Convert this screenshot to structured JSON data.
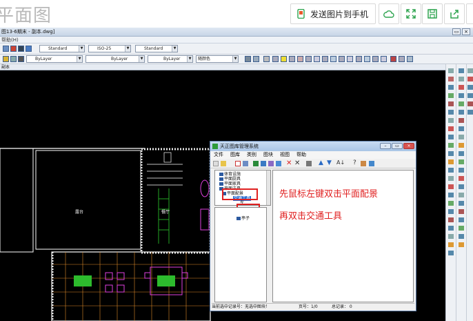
{
  "banner": {
    "title": "平面图",
    "send_label": "发送图片到手机",
    "colors": {
      "green": "#2ea44f"
    }
  },
  "app": {
    "title": "图13-6期末 - 副本.dwg]",
    "menu": "帮助(H)",
    "text_style": "Standard",
    "dim_style": "ISO-25",
    "table_style": "Standard",
    "layer": "ByLayer",
    "linetype": "ByLayer",
    "lineweight": "ByLayer",
    "color": "随颜色",
    "tab": "副本"
  },
  "dialog": {
    "title": "天正图库管理系统",
    "menu": [
      "文件",
      "图库",
      "类别",
      "图块",
      "视图",
      "帮助"
    ],
    "tree": [
      {
        "label": "体育设施"
      },
      {
        "label": "平面厨具"
      },
      {
        "label": "平面家具"
      },
      {
        "label": "平面洁具"
      },
      {
        "label": "平面配景"
      },
      {
        "label": "交通工具"
      },
      {
        "label": "车"
      },
      {
        "label": "人物"
      },
      {
        "label": "亭子"
      }
    ],
    "instruction_1": "先鼠标左键双击平面配景",
    "instruction_2": "再双击交通工具",
    "status": {
      "record": "当前选中记录号：无选中图块！",
      "page": "页号：1/0",
      "total": "总记录： 0"
    }
  },
  "cad_labels": {
    "room1": "露台",
    "room2": "餐厅"
  }
}
